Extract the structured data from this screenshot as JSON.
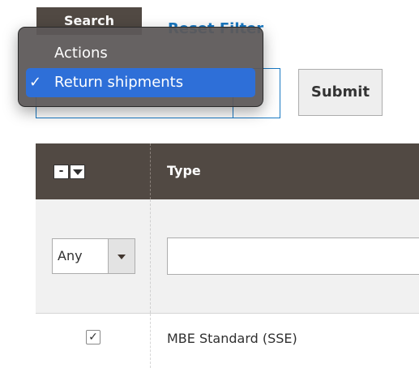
{
  "toolbar": {
    "search_label": "Search",
    "reset_filter_label": "Reset Filter",
    "submit_label": "Submit"
  },
  "actions_dropdown": {
    "options": [
      {
        "label": "Actions",
        "selected": false
      },
      {
        "label": "Return shipments",
        "selected": true
      }
    ],
    "checkmark": "✓"
  },
  "grid": {
    "columns": {
      "type_label": "Type"
    },
    "mass_select": {
      "symbol": "-"
    },
    "filters": {
      "select_value": "Any",
      "type_value": ""
    },
    "rows": [
      {
        "checked_symbol": "✓",
        "type": "MBE Standard (SSE)"
      }
    ]
  }
}
